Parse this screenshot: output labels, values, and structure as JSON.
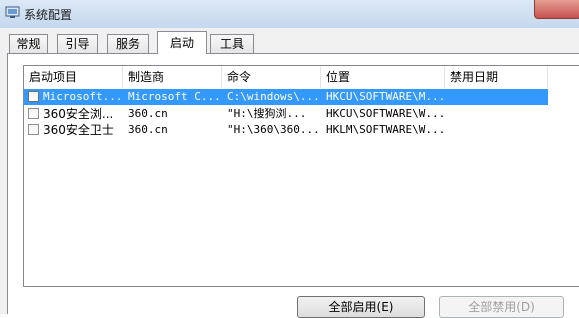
{
  "window": {
    "title": "系统配置"
  },
  "tabs": [
    {
      "label": "常规"
    },
    {
      "label": "引导"
    },
    {
      "label": "服务"
    },
    {
      "label": "启动"
    },
    {
      "label": "工具"
    }
  ],
  "list": {
    "columns": [
      "启动项目",
      "制造商",
      "命令",
      "位置",
      "禁用日期"
    ],
    "rows": [
      {
        "item": "Microsoft...",
        "maker": "Microsoft C...",
        "command": "C:\\windows\\...",
        "location": "HKCU\\SOFTWARE\\M...",
        "disabled_date": "",
        "checked": false,
        "selected": true
      },
      {
        "item": "360安全浏...",
        "maker": "360.cn",
        "command": "\"H:\\搜狗浏...",
        "location": "HKCU\\SOFTWARE\\W...",
        "disabled_date": "",
        "checked": false,
        "selected": false
      },
      {
        "item": "360安全卫士",
        "maker": "360.cn",
        "command": "\"H:\\360\\360...",
        "location": "HKLM\\SOFTWARE\\W...",
        "disabled_date": "",
        "checked": false,
        "selected": false
      }
    ]
  },
  "buttons": {
    "enable_all": "全部启用(E)",
    "disable_all": "全部禁用(D)"
  }
}
